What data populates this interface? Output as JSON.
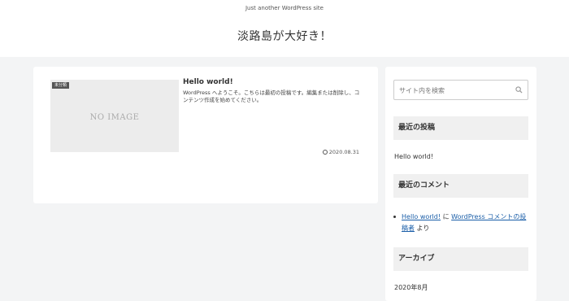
{
  "header": {
    "tagline": "Just another WordPress site",
    "site_title": "淡路島が大好き！"
  },
  "post": {
    "category": "未分類",
    "noimage": "NO IMAGE",
    "title": "Hello world!",
    "excerpt": "WordPress へようこそ。こちらは最初の投稿です。編集または削除し、コンテンツ作成を始めてください。",
    "date": "2020.08.31"
  },
  "sidebar": {
    "search_placeholder": "サイト内を検索",
    "recent_posts_title": "最近の投稿",
    "recent_post_item": "Hello world!",
    "recent_comments_title": "最近のコメント",
    "comment_author": "Hello world!",
    "comment_connector": " に ",
    "comment_post": "WordPress コメントの投稿者",
    "comment_suffix": " より",
    "archive_title": "アーカイブ",
    "archive_item": "2020年8月"
  },
  "icons": {
    "search": "search-icon",
    "clock": "clock-icon"
  },
  "colors": {
    "link": "#1a5ea8",
    "background": "#f3f4f5"
  }
}
